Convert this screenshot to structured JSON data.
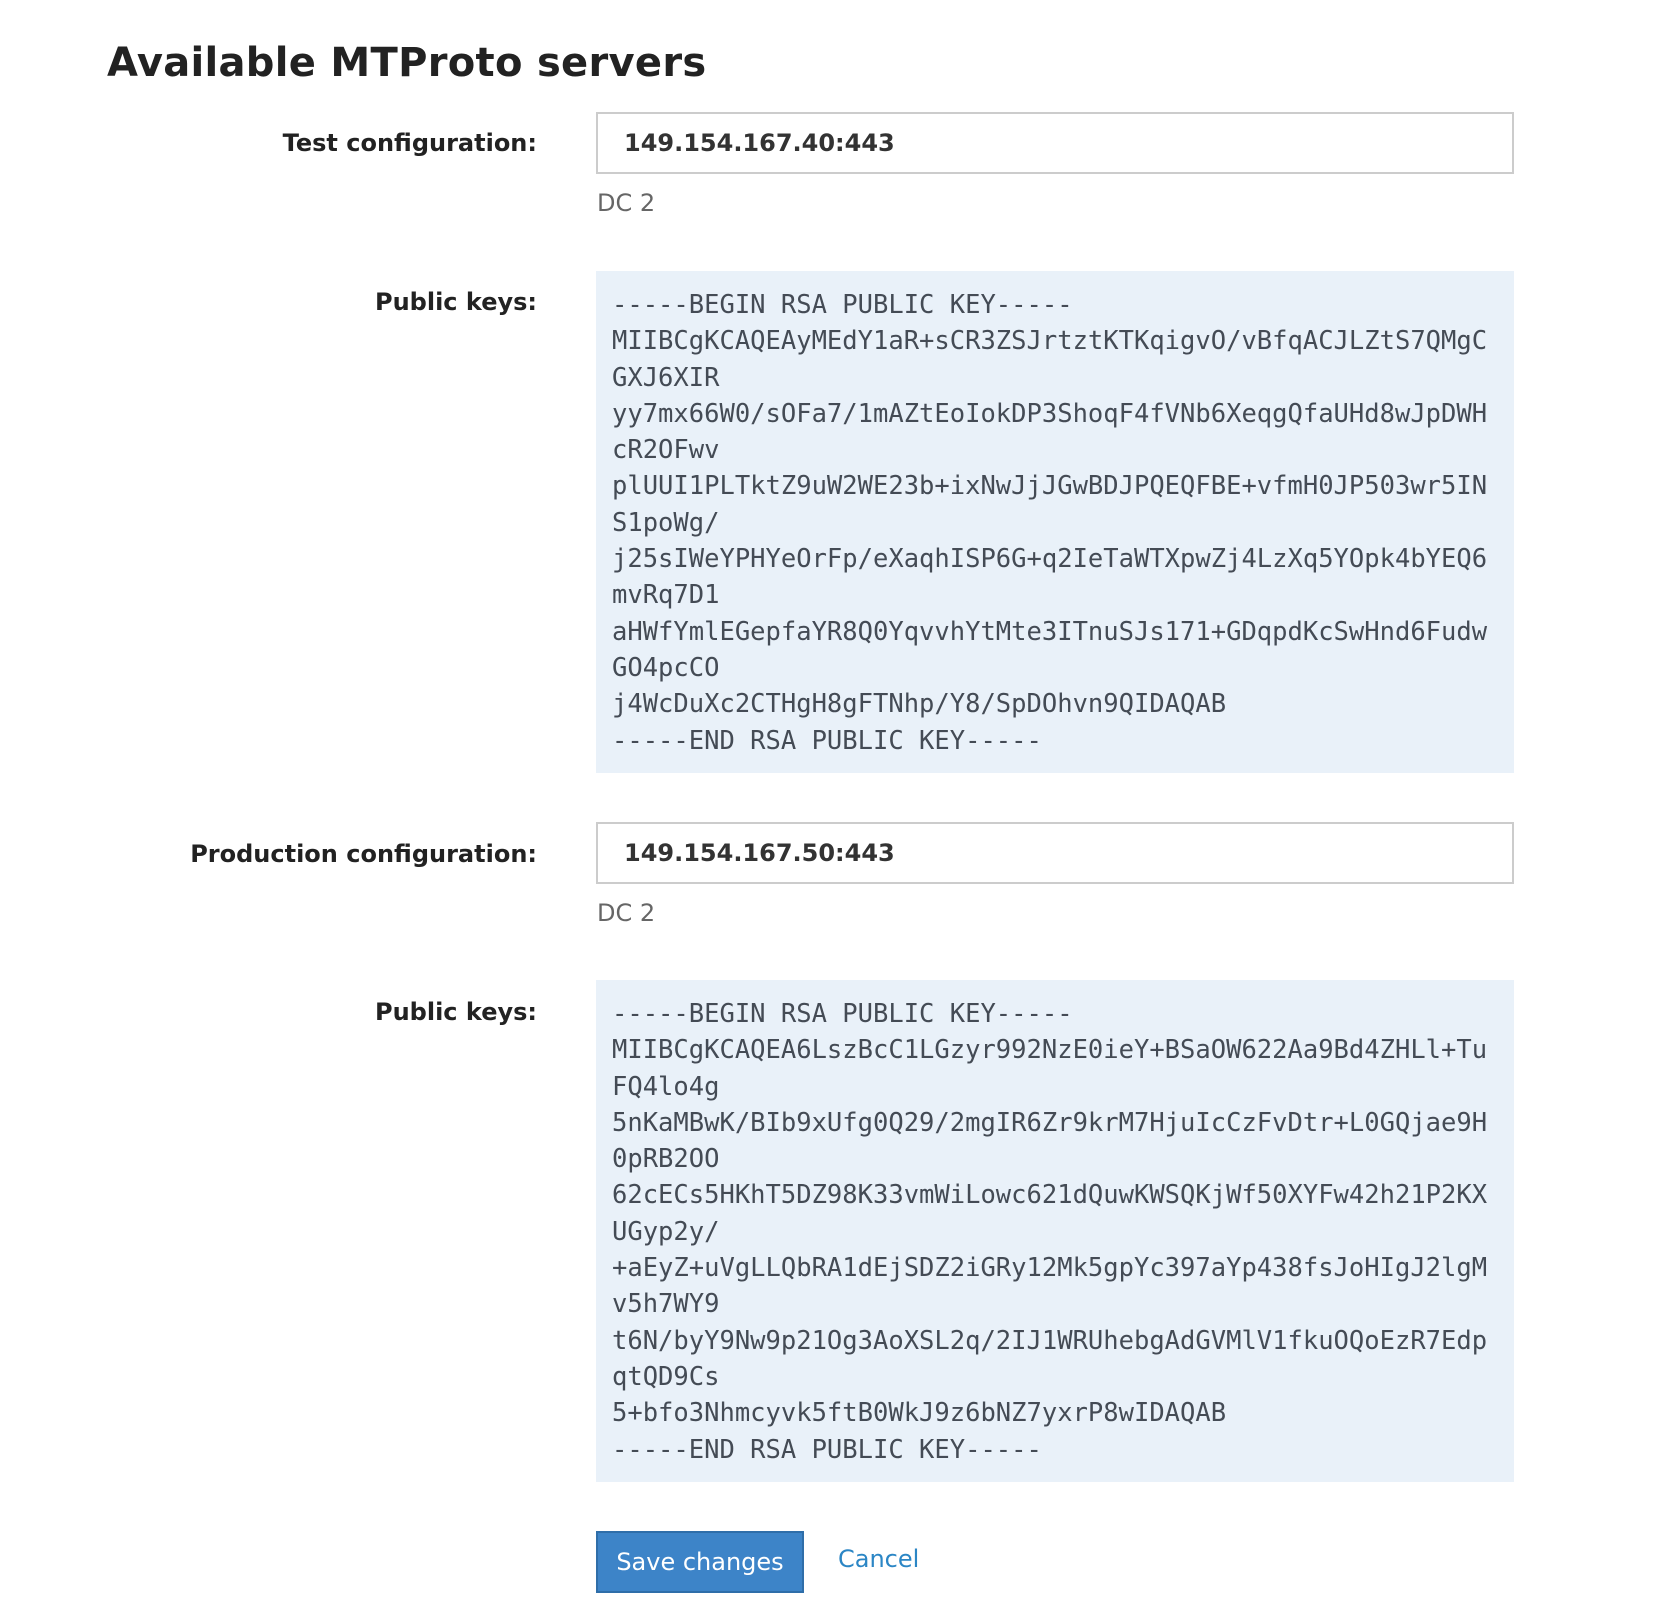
{
  "page": {
    "title": "Available MTProto servers"
  },
  "test": {
    "label": "Test configuration:",
    "address": "149.154.167.40:443",
    "dc": "DC 2",
    "keys_label": "Public keys:",
    "public_key": "-----BEGIN RSA PUBLIC KEY-----\nMIIBCgKCAQEAyMEdY1aR+sCR3ZSJrtztKTKqigvO/vBfqACJLZtS7QMgCGXJ6XIR\nyy7mx66W0/sOFa7/1mAZtEoIokDP3ShoqF4fVNb6XeqgQfaUHd8wJpDWHcR2OFwv\nplUUI1PLTktZ9uW2WE23b+ixNwJjJGwBDJPQEQFBE+vfmH0JP503wr5INS1poWg/\nj25sIWeYPHYeOrFp/eXaqhISP6G+q2IeTaWTXpwZj4LzXq5YOpk4bYEQ6mvRq7D1\naHWfYmlEGepfaYR8Q0YqvvhYtMte3ITnuSJs171+GDqpdKcSwHnd6FudwGO4pcCO\nj4WcDuXc2CTHgH8gFTNhp/Y8/SpDOhvn9QIDAQAB\n-----END RSA PUBLIC KEY-----"
  },
  "production": {
    "label": "Production configuration:",
    "address": "149.154.167.50:443",
    "dc": "DC 2",
    "keys_label": "Public keys:",
    "public_key": "-----BEGIN RSA PUBLIC KEY-----\nMIIBCgKCAQEA6LszBcC1LGzyr992NzE0ieY+BSaOW622Aa9Bd4ZHLl+TuFQ4lo4g\n5nKaMBwK/BIb9xUfg0Q29/2mgIR6Zr9krM7HjuIcCzFvDtr+L0GQjae9H0pRB2OO\n62cECs5HKhT5DZ98K33vmWiLowc621dQuwKWSQKjWf50XYFw42h21P2KXUGyp2y/\n+aEyZ+uVgLLQbRA1dEjSDZ2iGRy12Mk5gpYc397aYp438fsJoHIgJ2lgMv5h7WY9\nt6N/byY9Nw9p21Og3AoXSL2q/2IJ1WRUhebgAdGVMlV1fkuOQoEzR7EdpqtQD9Cs\n5+bfo3Nhmcyvk5ftB0WkJ9z6bNZ7yxrP8wIDAQAB\n-----END RSA PUBLIC KEY-----"
  },
  "actions": {
    "save_label": "Save changes",
    "cancel_label": "Cancel"
  },
  "colors": {
    "primary_button": "#3d84c8",
    "link": "#2b86c5",
    "key_background": "#e9f1f9"
  }
}
